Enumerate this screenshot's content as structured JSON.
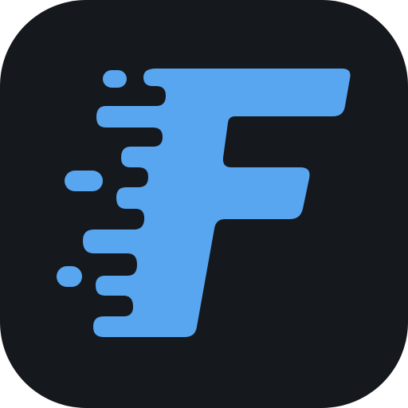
{
  "icon": {
    "name": "speed-f-logo-icon",
    "letter": "F",
    "background_color": "#15181d",
    "glyph_color": "#58a6f0"
  }
}
